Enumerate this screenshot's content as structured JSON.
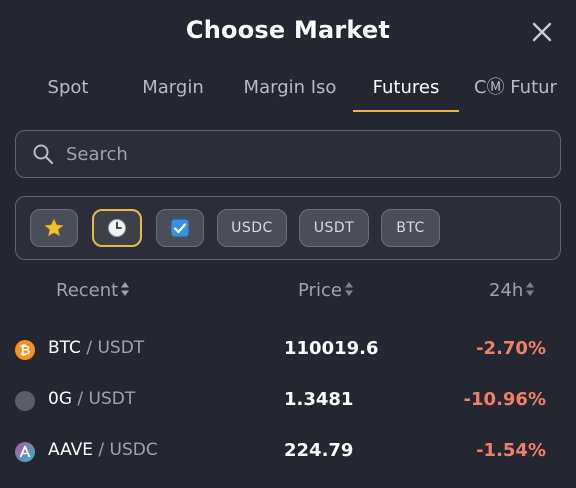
{
  "header": {
    "title": "Choose Market",
    "close_icon": "close-icon"
  },
  "tabs": [
    {
      "label": "Spot",
      "active": false
    },
    {
      "label": "Margin",
      "active": false
    },
    {
      "label": "Margin Iso",
      "active": false
    },
    {
      "label": "Futures",
      "active": true
    },
    {
      "label": "CⓂ Futur",
      "active": false
    }
  ],
  "search": {
    "placeholder": "Search",
    "value": "",
    "icon": "search-icon"
  },
  "filters": [
    {
      "id": "favorites",
      "icon": "star-icon",
      "label": ""
    },
    {
      "id": "recent",
      "icon": "clock-icon",
      "label": "",
      "active": true
    },
    {
      "id": "checked",
      "icon": "checkbox-icon",
      "label": ""
    },
    {
      "id": "usdc",
      "label": "USDC"
    },
    {
      "id": "usdt",
      "label": "USDT"
    },
    {
      "id": "btc",
      "label": "BTC"
    }
  ],
  "columns": {
    "name": "Recent",
    "price": "Price",
    "change": "24h"
  },
  "rows": [
    {
      "base": "BTC",
      "quote": "/ USDT",
      "price": "110019.6",
      "change": "-2.70%",
      "coin_icon": "bitcoin-icon"
    },
    {
      "base": "0G",
      "quote": "/ USDT",
      "price": "1.3481",
      "change": "-10.96%",
      "coin_icon": "0g-coin-icon"
    },
    {
      "base": "AAVE",
      "quote": "/ USDC",
      "price": "224.79",
      "change": "-1.54%",
      "coin_icon": "aave-icon"
    }
  ],
  "colors": {
    "background": "#242731",
    "accent": "#e9b84a",
    "negative": "#f0806a",
    "muted": "#9ea3ad"
  }
}
